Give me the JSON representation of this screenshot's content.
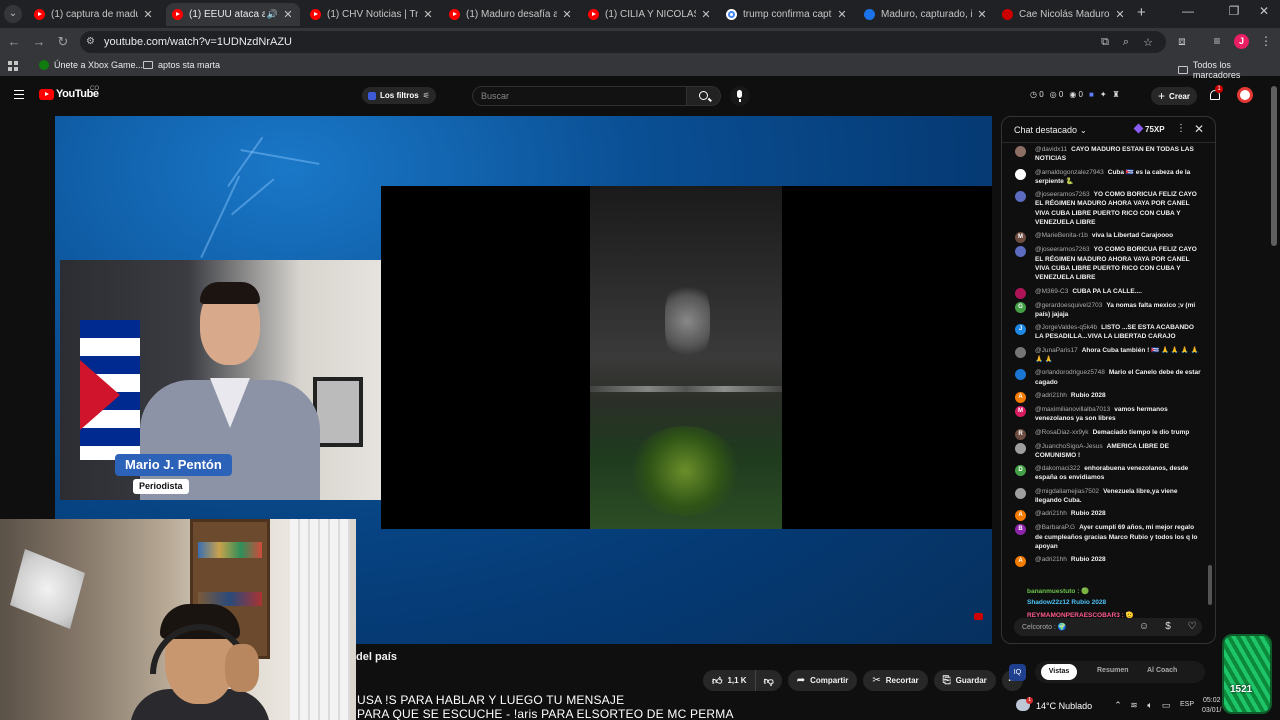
{
  "browser": {
    "tabs": [
      {
        "title": "(1) captura de maduro - Y",
        "icon": "youtube-icon",
        "active": false
      },
      {
        "title": "(1) EEUU ataca al régi",
        "icon": "youtube-icon",
        "active": true
      },
      {
        "title": "(1) CHV Noticias | Tru",
        "icon": "youtube-icon",
        "active": false
      },
      {
        "title": "(1) Maduro desafía a Trun",
        "icon": "youtube-icon",
        "active": false
      },
      {
        "title": "(1) CILIA Y NICOLAS MAD",
        "icon": "youtube-icon",
        "active": false
      },
      {
        "title": "trump confirma captura d",
        "icon": "google-icon",
        "active": false
      },
      {
        "title": "Maduro, capturado, infor",
        "icon": "news-icon",
        "active": false
      },
      {
        "title": "Cae Nicolás Maduro: Esta",
        "icon": "news-red-icon",
        "active": false
      }
    ],
    "url": "youtube.com/watch?v=1UDNzdNrAZU",
    "bookmarks": [
      {
        "label": "Únete a Xbox Game...",
        "icon": "xbox-icon"
      },
      {
        "label": "aptos sta marta",
        "icon": "folder-icon"
      }
    ],
    "all_bookmarks": "Todos los marcadores",
    "profile_initial": "J"
  },
  "youtube": {
    "logo_text": "YouTube",
    "logo_country": "CO",
    "filters_label": "Los filtros",
    "search_placeholder": "Buscar",
    "header_stats": [
      "0",
      "0",
      "0"
    ],
    "create_label": "Crear",
    "notification_count": "1"
  },
  "video": {
    "lower_third_name": "Mario J. Pentón",
    "lower_third_role": "Periodista"
  },
  "below_video": {
    "title": "del país",
    "like_count": "1,1 K",
    "share_label": "Compartir",
    "clip_label": "Recortar",
    "save_label": "Guardar"
  },
  "overlay": {
    "line1": "USA !S PARA HABLAR Y LUEGO TU MENSAJE",
    "line2": "PARA QUE SE ESCUCHE - !aris PARA ELSORTEO DE MC PERMA"
  },
  "chat": {
    "header": "Chat destacado",
    "xp": "75XP",
    "input_placeholder": "Chatea como...",
    "messages": [
      {
        "author": "@davidx11",
        "text": "CAYO MADURO ESTAN EN TODAS LAS NOTICIAS",
        "avatar": "",
        "color": "#8d6e63"
      },
      {
        "author": "@arnaldogonzalez7943",
        "text": "Cuba 🇨🇺 es la cabeza de la serpiente 🐍",
        "avatar": "",
        "color": "#ffffff"
      },
      {
        "author": "@joseeramos7263",
        "text": "YO COMO BORICUA FELIZ CAYO EL RÉGIMEN MADURO AHORA VAYA POR CANEL VIVA CUBA LIBRE PUERTO RICO CON CUBA Y VENEZUELA LIBRE",
        "avatar": "",
        "color": "#5c6bc0"
      },
      {
        "author": "@MarieBenita-r1b",
        "text": "viva la Libertad Carajoooo",
        "avatar": "M",
        "color": "#6d4c41"
      },
      {
        "author": "@joseeramos7263",
        "text": "YO COMO BORICUA FELIZ CAYO EL RÉGIMEN MADURO AHORA VAYA POR CANEL VIVA CUBA LIBRE PUERTO RICO CON CUBA Y VENEZUELA LIBRE",
        "avatar": "",
        "color": "#5c6bc0"
      },
      {
        "author": "@M369-C3",
        "text": "CUBA PA LA CALLE....",
        "avatar": "",
        "color": "#ad1457"
      },
      {
        "author": "@gerardoesquivel2703",
        "text": "Ya nomas falta mexico ;v (mi país) jajaja",
        "avatar": "G",
        "color": "#43a047"
      },
      {
        "author": "@JorgeValdes-q5k4b",
        "text": "LISTO ...SE ESTA ACABANDO LA PESADILLA...VIVA LA LIBERTAD CARAJO",
        "avatar": "J",
        "color": "#1e88e5"
      },
      {
        "author": "@JunaParis17",
        "text": "Ahora Cuba también ! 🇨🇺 🙏 🙏 🙏 🙏 🙏 🙏",
        "avatar": "",
        "color": "#757575"
      },
      {
        "author": "@orlandorodriguez5748",
        "text": "Mario el Canelo debe de estar cagado",
        "avatar": "",
        "color": "#1976d2"
      },
      {
        "author": "@adri21hh",
        "text": "Rubio 2028",
        "avatar": "A",
        "color": "#f57c00"
      },
      {
        "author": "@maximilianovillalba7013",
        "text": "vamos hermanos venezolanos ya son libres",
        "avatar": "M",
        "color": "#d81b60"
      },
      {
        "author": "@RosaDiaz-xx9yk",
        "text": "Demaciado tiempo le dio trump",
        "avatar": "R",
        "color": "#6d4c41"
      },
      {
        "author": "@JuanchoSigoA-Jesus",
        "text": "AMERICA LIBRE DE COMUNISMO !",
        "avatar": "",
        "color": "#9e9e9e"
      },
      {
        "author": "@dakomaci322",
        "text": "enhorabuena venezolanos, desde españa os envidiamos",
        "avatar": "D",
        "color": "#43a047"
      },
      {
        "author": "@migdaliamejias7502",
        "text": "Venezuela libre,ya viene llegando Cuba.",
        "avatar": "",
        "color": "#9e9e9e"
      },
      {
        "author": "@adri21hh",
        "text": "Rubio 2028",
        "avatar": "A",
        "color": "#f57c00"
      },
      {
        "author": "@BarbaraP.G",
        "text": "Ayer cumplí 69 años, mi mejor regalo de cumpleaños gracias Marco Rubio y todos los q lo apoyan",
        "avatar": "B",
        "color": "#8e24aa"
      },
      {
        "author": "@adri21hh",
        "text": "Rubio 2028",
        "avatar": "A",
        "color": "#f57c00"
      }
    ],
    "floating": [
      {
        "text": "bananmuestuto : 🟢",
        "color": "#6cc24a"
      },
      {
        "text": "Shadow22z12 Rubio 2028",
        "color": "#4fc3f7"
      },
      {
        "text": "REYMAMONPERAESCOBAR3 : 🫡",
        "color": "#ff5a8c"
      },
      {
        "text": "Celcoroto : 🌍",
        "color": "#aaaaaa"
      }
    ]
  },
  "lower_tabs": {
    "items": [
      "Vistas",
      "Resumen",
      "Al Coach"
    ]
  },
  "taskbar": {
    "temperature": "14°C",
    "weather": "Nublado",
    "language": "ESP",
    "time": "05:02",
    "date": "03/01/"
  },
  "badge": {
    "number": "1521"
  },
  "colors": {
    "youtube_red": "#ff0000",
    "lower_third_blue": "#2c62b8",
    "video_blue": "#0a4f94"
  }
}
